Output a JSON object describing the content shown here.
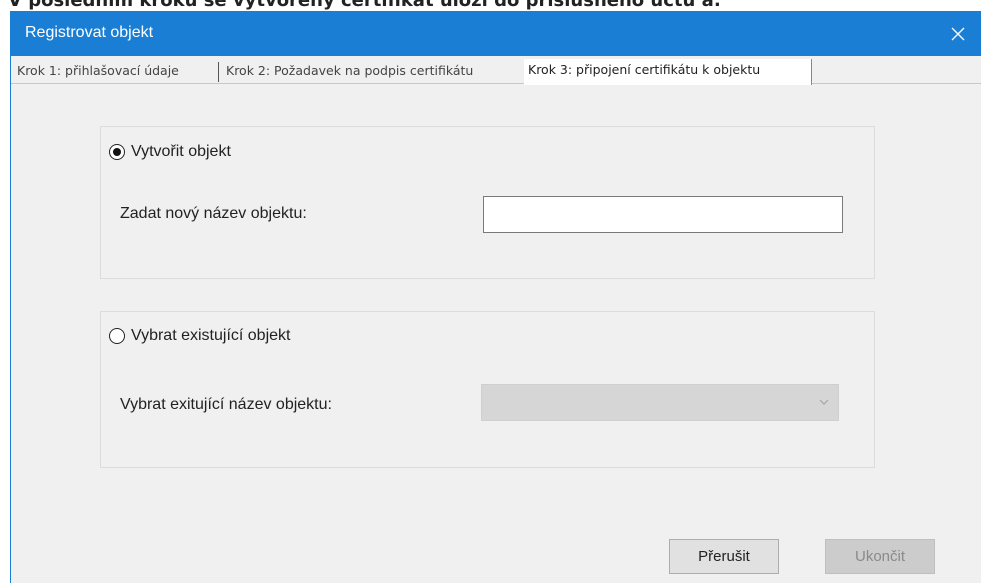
{
  "caption": "V posledním kroku se vytvořený certifikát uloží do příslušného účtu a:",
  "window": {
    "title": "Registrovat objekt"
  },
  "tabs": [
    {
      "label": "Krok 1: přihlašovací údaje",
      "active": false
    },
    {
      "label": "Krok 2: Požadavek na podpis certifikátu",
      "active": false
    },
    {
      "label": "Krok 3: připojení certifikátu k objektu",
      "active": true
    }
  ],
  "create_group": {
    "radio_label": "Vytvořit objekt",
    "selected": true,
    "field_label": "Zadat nový název objektu:",
    "input_value": ""
  },
  "select_group": {
    "radio_label": "Vybrat existující objekt",
    "selected": false,
    "field_label": "Vybrat exitující název objektu:",
    "select_value": ""
  },
  "buttons": {
    "cancel_label": "Přerušit",
    "finish_label": "Ukončit"
  },
  "colors": {
    "titlebar": "#1a7fd4",
    "window_bg": "#f0f0f0",
    "disabled_bg": "#cccccc"
  },
  "icons": {
    "close": "close-icon",
    "dropdown": "chevron-down-icon"
  }
}
